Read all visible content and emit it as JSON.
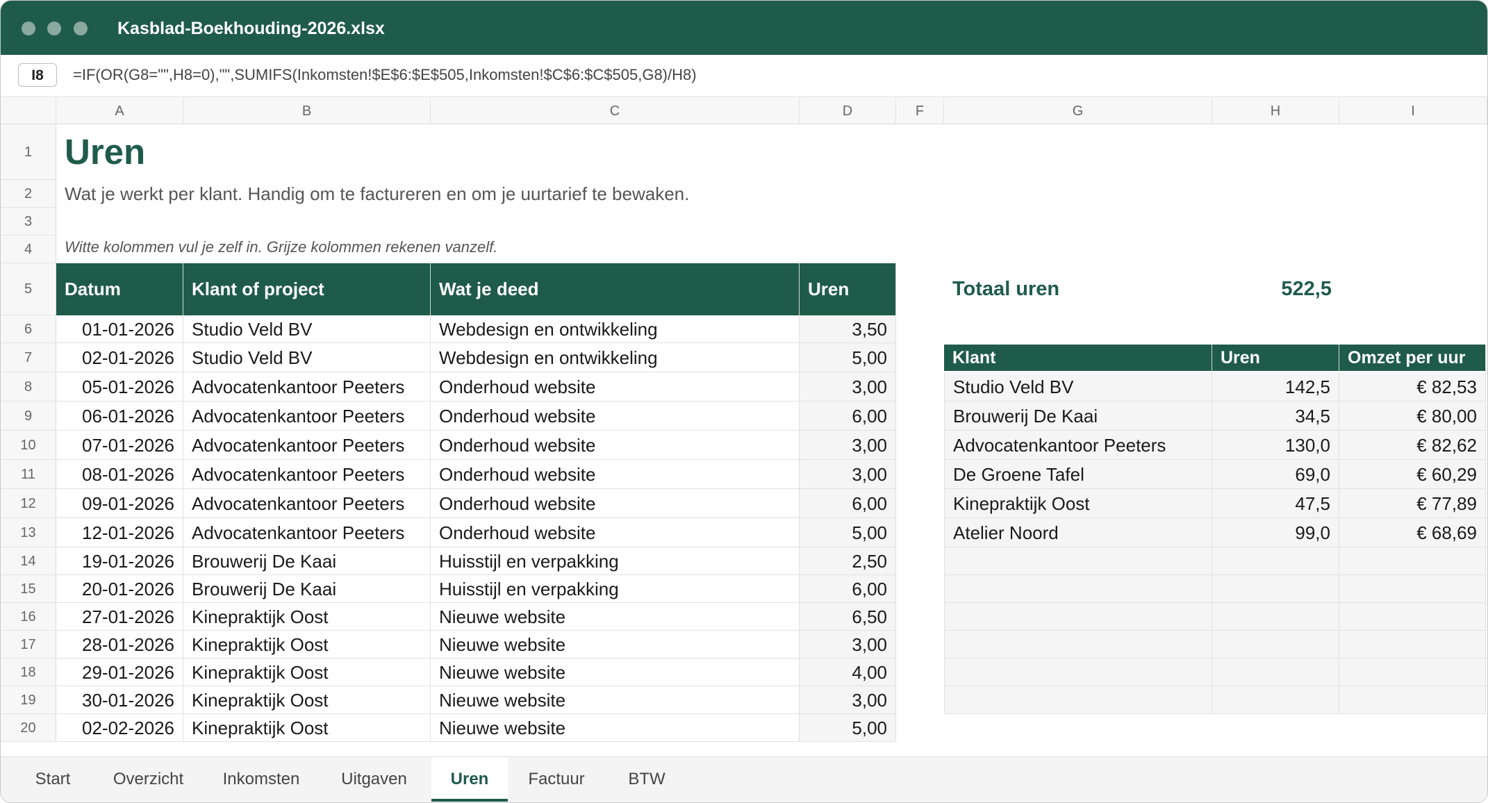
{
  "window": {
    "title": "Kasblad-Boekhouding-2026.xlsx"
  },
  "formula_bar": {
    "cell_ref": "I8",
    "formula": "=IF(OR(G8=\"\",H8=0),\"\",SUMIFS(Inkomsten!$E$6:$E$505,Inkomsten!$C$6:$C$505,G8)/H8)"
  },
  "columns": [
    "A",
    "B",
    "C",
    "D",
    "F",
    "G",
    "H",
    "I"
  ],
  "rows": [
    "1",
    "2",
    "3",
    "4",
    "5",
    "6",
    "7",
    "8",
    "9",
    "10",
    "11",
    "12",
    "13",
    "14",
    "15",
    "16",
    "17",
    "18",
    "19",
    "20"
  ],
  "sheet": {
    "title": "Uren",
    "subtitle": "Wat je werkt per klant. Handig om te factureren en om je uurtarief te bewaken.",
    "note": "Witte kolommen vul je zelf in. Grijze kolommen rekenen vanzelf.",
    "headers": [
      "Datum",
      "Klant of project",
      "Wat je deed",
      "Uren"
    ],
    "entries": [
      {
        "date": "01-01-2026",
        "client": "Studio Veld BV",
        "task": "Webdesign en ontwikkeling",
        "hours": "3,50"
      },
      {
        "date": "02-01-2026",
        "client": "Studio Veld BV",
        "task": "Webdesign en ontwikkeling",
        "hours": "5,00"
      },
      {
        "date": "05-01-2026",
        "client": "Advocatenkantoor Peeters",
        "task": "Onderhoud website",
        "hours": "3,00"
      },
      {
        "date": "06-01-2026",
        "client": "Advocatenkantoor Peeters",
        "task": "Onderhoud website",
        "hours": "6,00"
      },
      {
        "date": "07-01-2026",
        "client": "Advocatenkantoor Peeters",
        "task": "Onderhoud website",
        "hours": "3,00"
      },
      {
        "date": "08-01-2026",
        "client": "Advocatenkantoor Peeters",
        "task": "Onderhoud website",
        "hours": "3,00"
      },
      {
        "date": "09-01-2026",
        "client": "Advocatenkantoor Peeters",
        "task": "Onderhoud website",
        "hours": "6,00"
      },
      {
        "date": "12-01-2026",
        "client": "Advocatenkantoor Peeters",
        "task": "Onderhoud website",
        "hours": "5,00"
      },
      {
        "date": "19-01-2026",
        "client": "Brouwerij De Kaai",
        "task": "Huisstijl en verpakking",
        "hours": "2,50"
      },
      {
        "date": "20-01-2026",
        "client": "Brouwerij De Kaai",
        "task": "Huisstijl en verpakking",
        "hours": "6,00"
      },
      {
        "date": "27-01-2026",
        "client": "Kinepraktijk Oost",
        "task": "Nieuwe website",
        "hours": "6,50"
      },
      {
        "date": "28-01-2026",
        "client": "Kinepraktijk Oost",
        "task": "Nieuwe website",
        "hours": "3,00"
      },
      {
        "date": "29-01-2026",
        "client": "Kinepraktijk Oost",
        "task": "Nieuwe website",
        "hours": "4,00"
      },
      {
        "date": "30-01-2026",
        "client": "Kinepraktijk Oost",
        "task": "Nieuwe website",
        "hours": "3,00"
      },
      {
        "date": "02-02-2026",
        "client": "Kinepraktijk Oost",
        "task": "Nieuwe website",
        "hours": "5,00"
      }
    ],
    "total_label": "Totaal uren",
    "total_value": "522,5",
    "summary_headers": [
      "Klant",
      "Uren",
      "Omzet per uur"
    ],
    "summary": [
      {
        "client": "Studio Veld BV",
        "hours": "142,5",
        "rate": "€ 82,53"
      },
      {
        "client": "Brouwerij De Kaai",
        "hours": "34,5",
        "rate": "€ 80,00"
      },
      {
        "client": "Advocatenkantoor Peeters",
        "hours": "130,0",
        "rate": "€ 82,62"
      },
      {
        "client": "De Groene Tafel",
        "hours": "69,0",
        "rate": "€ 60,29"
      },
      {
        "client": "Kinepraktijk Oost",
        "hours": "47,5",
        "rate": "€ 77,89"
      },
      {
        "client": "Atelier Noord",
        "hours": "99,0",
        "rate": "€ 68,69"
      },
      {
        "client": "",
        "hours": "",
        "rate": ""
      },
      {
        "client": "",
        "hours": "",
        "rate": ""
      },
      {
        "client": "",
        "hours": "",
        "rate": ""
      },
      {
        "client": "",
        "hours": "",
        "rate": ""
      },
      {
        "client": "",
        "hours": "",
        "rate": ""
      },
      {
        "client": "",
        "hours": "",
        "rate": ""
      }
    ]
  },
  "tabs": [
    "Start",
    "Overzicht",
    "Inkomsten",
    "Uitgaven",
    "Uren",
    "Factuur",
    "BTW"
  ],
  "active_tab": "Uren",
  "colors": {
    "accent": "#1f5b4a",
    "header_bg": "#f7f7f7",
    "computed_bg": "#f5f5f5"
  }
}
